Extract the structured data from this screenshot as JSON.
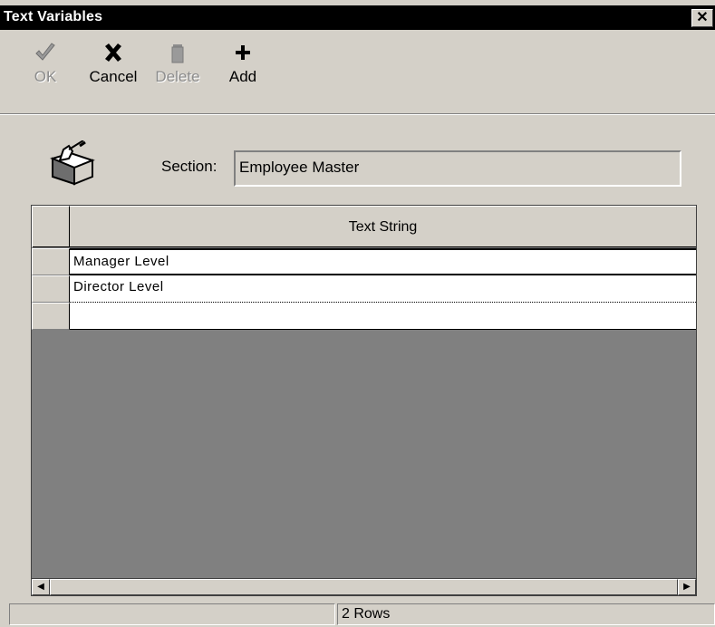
{
  "window": {
    "title": "Text Variables",
    "close_glyph": "✕"
  },
  "toolbar": {
    "ok": {
      "label": "OK",
      "icon": "checkmark-icon",
      "enabled": false
    },
    "cancel": {
      "label": "Cancel",
      "icon": "x-icon",
      "enabled": true
    },
    "delete": {
      "label": "Delete",
      "icon": "trash-icon",
      "enabled": false
    },
    "add": {
      "label": "Add",
      "icon": "plus-icon",
      "enabled": true
    }
  },
  "section": {
    "label": "Section:",
    "value": "Employee Master",
    "icon": "hand-writing-book-icon"
  },
  "grid": {
    "column_header": "Text String",
    "rows": [
      {
        "text": "Manager Level"
      },
      {
        "text": "Director Level"
      },
      {
        "text": ""
      }
    ]
  },
  "status": {
    "left": "",
    "rows": "2 Rows"
  },
  "colors": {
    "titlebar": "#000000",
    "window_bg": "#d4d0c8",
    "grid_bg": "#808080",
    "disabled_text": "#8c8c8c"
  }
}
